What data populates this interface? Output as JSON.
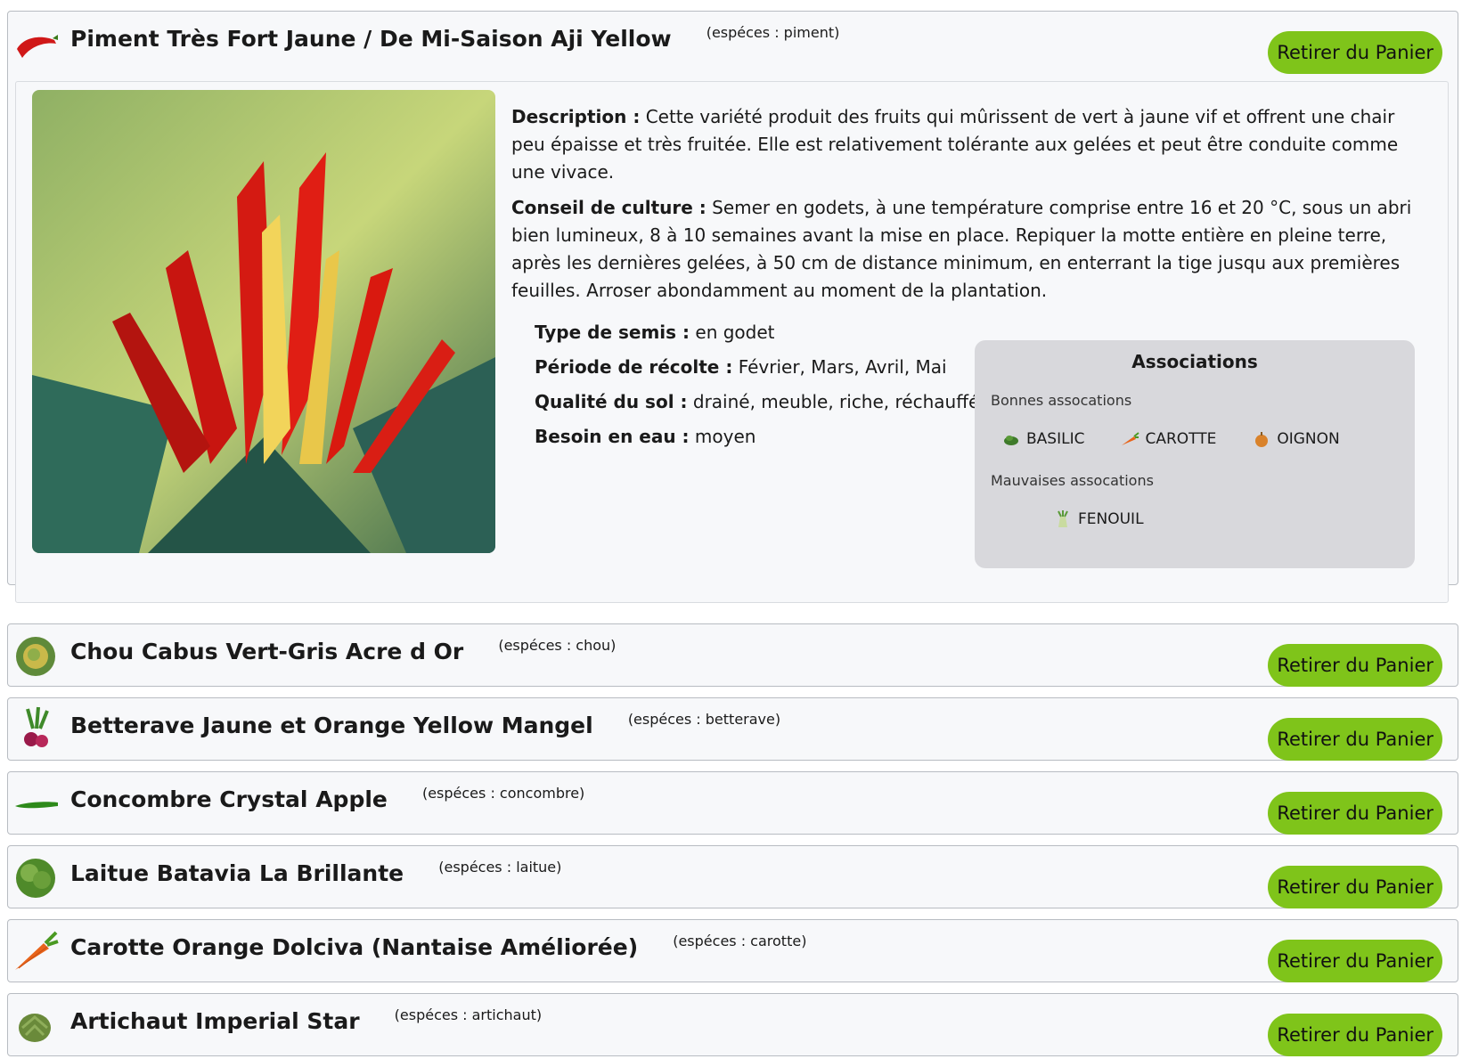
{
  "cart": {
    "items": [
      {
        "title": "Piment Très Fort Jaune / De Mi-Saison Aji Yellow",
        "species": "(espéces : piment)",
        "icon": "chili-pepper-icon",
        "button": "Retirer du Panier",
        "expanded": true,
        "details": {
          "description_label": "Description :",
          "description": "Cette variété produit des fruits qui mûrissent de vert à jaune vif et offrent une chair peu épaisse et très fruitée. Elle est relativement tolérante aux gelées et peut être conduite comme une vivace.",
          "culture_label": "Conseil de culture :",
          "culture": "Semer en godets, à une température comprise entre 16 et 20 °C, sous un abri bien lumineux, 8 à 10 semaines avant la mise en place. Repiquer la motte entière en pleine terre, après les dernières gelées, à 50 cm de distance minimum, en enterrant la tige jusqu aux premières feuilles. Arroser abondamment au moment de la plantation.",
          "facts": [
            {
              "label": "Type de semis :",
              "value": "en godet"
            },
            {
              "label": "Période de récolte :",
              "value": "Février, Mars, Avril, Mai"
            },
            {
              "label": "Qualité du sol :",
              "value": "drainé, meuble, riche, réchauffé"
            },
            {
              "label": "Besoin en eau :",
              "value": "moyen"
            }
          ],
          "associations": {
            "title": "Associations",
            "good_label": "Bonnes assocations",
            "good": [
              {
                "name": "BASILIC",
                "icon": "basil-icon"
              },
              {
                "name": "CAROTTE",
                "icon": "carrot-icon"
              },
              {
                "name": "OIGNON",
                "icon": "onion-icon"
              }
            ],
            "bad_label": "Mauvaises assocations",
            "bad": [
              {
                "name": "FENOUIL",
                "icon": "fennel-icon"
              }
            ]
          }
        }
      },
      {
        "title": "Chou Cabus Vert-Gris Acre d Or",
        "species": "(espéces : chou)",
        "icon": "cabbage-icon",
        "button": "Retirer du Panier"
      },
      {
        "title": "Betterave Jaune et Orange Yellow Mangel",
        "species": "(espéces : betterave)",
        "icon": "beet-icon",
        "button": "Retirer du Panier"
      },
      {
        "title": "Concombre Crystal Apple",
        "species": "(espéces : concombre)",
        "icon": "cucumber-icon",
        "button": "Retirer du Panier"
      },
      {
        "title": "Laitue Batavia La Brillante",
        "species": "(espéces : laitue)",
        "icon": "lettuce-icon",
        "button": "Retirer du Panier"
      },
      {
        "title": "Carotte Orange Dolciva (Nantaise Améliorée)",
        "species": "(espéces : carotte)",
        "icon": "carrot-icon",
        "button": "Retirer du Panier"
      },
      {
        "title": "Artichaut Imperial Star",
        "species": "(espéces : artichaut)",
        "icon": "artichoke-icon",
        "button": "Retirer du Panier"
      }
    ]
  },
  "colors": {
    "button": "#7fc41a",
    "card_bg": "#f7f8fa",
    "assoc_bg": "#d8d8dc"
  }
}
